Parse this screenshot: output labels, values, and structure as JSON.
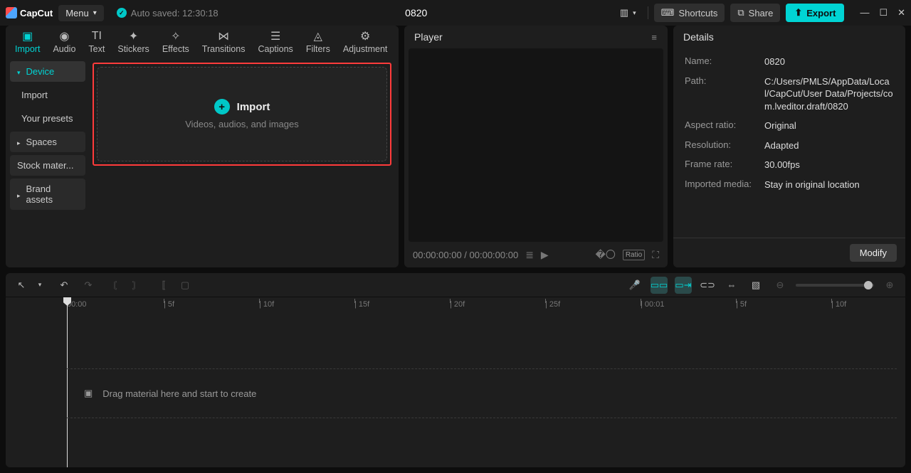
{
  "titlebar": {
    "app_name": "CapCut",
    "menu_label": "Menu",
    "autosave_label": "Auto saved: 12:30:18",
    "project_title": "0820",
    "shortcuts": "Shortcuts",
    "share": "Share",
    "export": "Export"
  },
  "tabs": {
    "import": "Import",
    "audio": "Audio",
    "text": "Text",
    "stickers": "Stickers",
    "effects": "Effects",
    "transitions": "Transitions",
    "captions": "Captions",
    "filters": "Filters",
    "adjustment": "Adjustment"
  },
  "leftnav": {
    "device": "Device",
    "import": "Import",
    "presets": "Your presets",
    "spaces": "Spaces",
    "stock": "Stock mater...",
    "brand": "Brand assets"
  },
  "import_drop": {
    "title": "Import",
    "subtitle": "Videos, audios, and images"
  },
  "player": {
    "title": "Player",
    "time": "00:00:00:00 / 00:00:00:00",
    "ratio": "Ratio"
  },
  "details": {
    "title": "Details",
    "name_k": "Name:",
    "name_v": "0820",
    "path_k": "Path:",
    "path_v": "C:/Users/PMLS/AppData/Local/CapCut/User Data/Projects/com.lveditor.draft/0820",
    "aspect_k": "Aspect ratio:",
    "aspect_v": "Original",
    "res_k": "Resolution:",
    "res_v": "Adapted",
    "fps_k": "Frame rate:",
    "fps_v": "30.00fps",
    "media_k": "Imported media:",
    "media_v": "Stay in original location",
    "modify": "Modify"
  },
  "timeline": {
    "drop_hint": "Drag material here and start to create",
    "ticks": [
      {
        "pos": 86,
        "label": "00:00",
        "major": true
      },
      {
        "pos": 222,
        "label": "| 5f"
      },
      {
        "pos": 356,
        "label": "| 10f"
      },
      {
        "pos": 490,
        "label": "| 15f"
      },
      {
        "pos": 624,
        "label": "| 20f"
      },
      {
        "pos": 758,
        "label": "| 25f"
      },
      {
        "pos": 892,
        "label": "| 00:01",
        "major": true
      },
      {
        "pos": 1026,
        "label": "| 5f"
      },
      {
        "pos": 1160,
        "label": "| 10f"
      }
    ]
  }
}
